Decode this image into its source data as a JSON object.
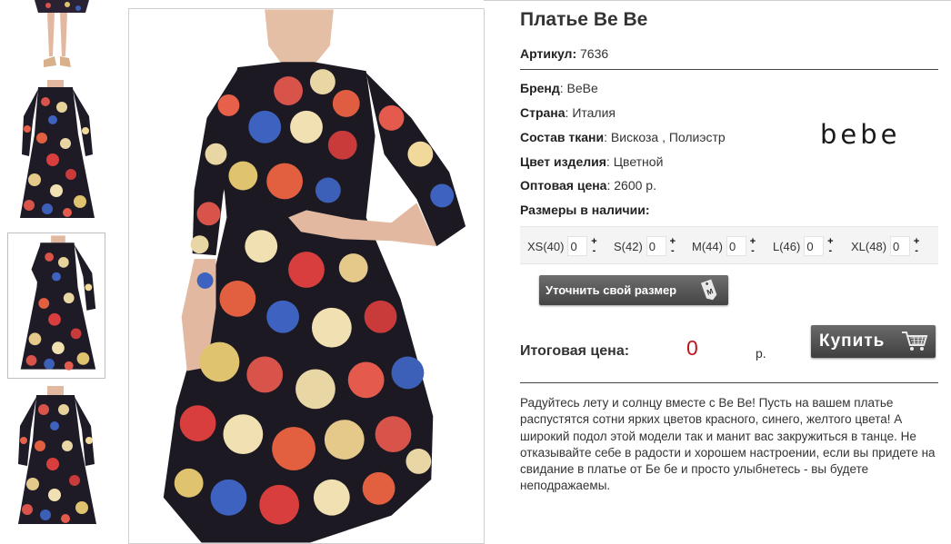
{
  "product": {
    "title": "Платье Be Be",
    "sku_label": "Артикул:",
    "sku_value": "7636",
    "brand_label": "Бренд",
    "brand_value": "BeBe",
    "country_label": "Страна",
    "country_value": "Италия",
    "fabric_label": "Состав ткани",
    "fabric_value": "Вискоза , Полиэстр",
    "color_label": "Цвет изделия",
    "color_value": "Цветной",
    "price_label": "Оптовая цена",
    "price_value": "2600 р.",
    "sizes_label": "Размеры в наличии:",
    "brand_logo_text": "bebe"
  },
  "sizes": [
    {
      "label": "XS(40)",
      "qty": "0"
    },
    {
      "label": "S(42)",
      "qty": "0"
    },
    {
      "label": "M(44)",
      "qty": "0"
    },
    {
      "label": "L(46)",
      "qty": "0"
    },
    {
      "label": "XL(48)",
      "qty": "0"
    }
  ],
  "actions": {
    "size_button": "Уточнить свой размер",
    "size_tag_letter": "M",
    "buy_button": "Купить"
  },
  "total": {
    "label": "Итоговая цена:",
    "value": "0",
    "currency": "р."
  },
  "description": "Радуйтесь лету и солнцу вместе с Be Be! Пусть на вашем платье распустятся сотни ярких цветов красного, синего, желтого цвета! А широкий подол этой модели так и манит вас закружиться в танце. Не отказывайте себе в радости и хорошем настроении, если вы придете на свидание в платье от Бе бе и просто улыбнетесь - вы будете неподражаемы.",
  "colors": {
    "accent_price": "#c0151b",
    "button_dark": "#444444"
  }
}
